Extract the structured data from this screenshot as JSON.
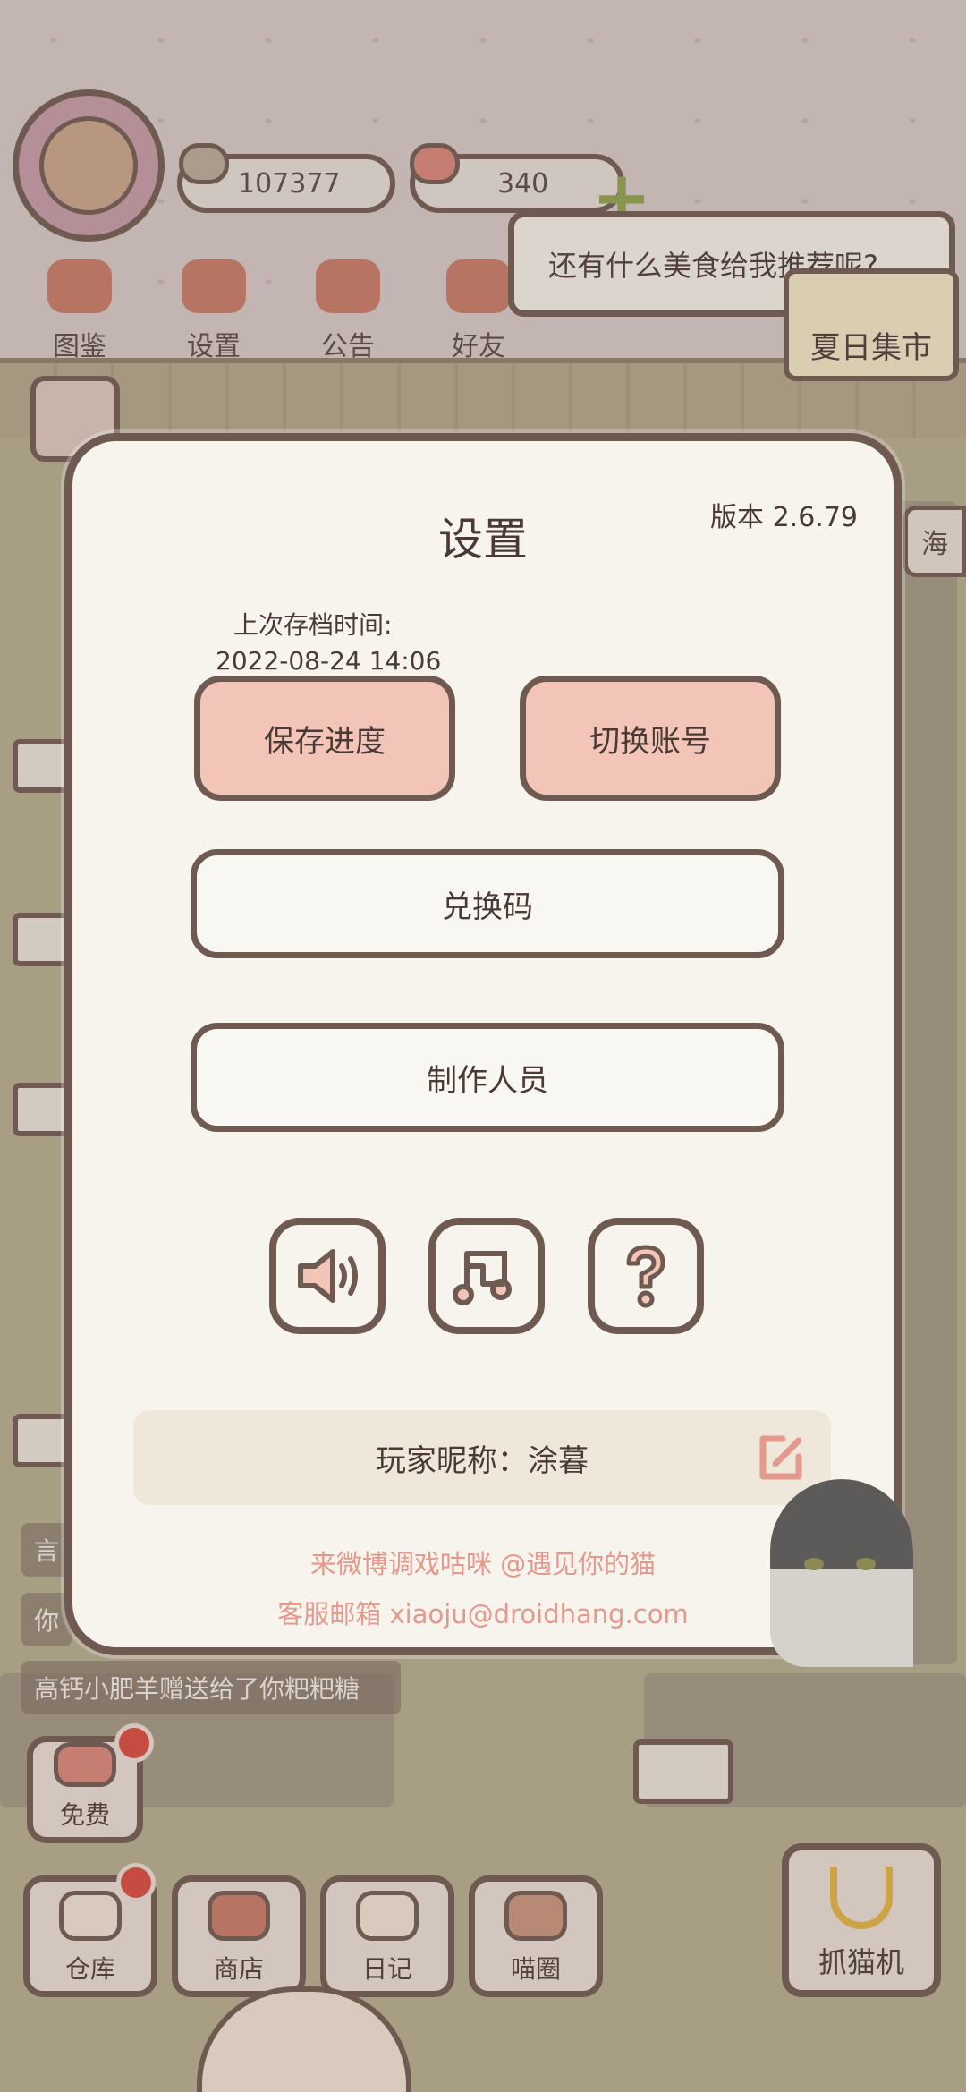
{
  "hud": {
    "fish_count": "107377",
    "heart_count": "340",
    "speech_bubble": "还有什么美食给我推荐呢?",
    "event_badge": "夏日集市",
    "side_tag": "海",
    "top_menu": [
      {
        "label": "图鉴",
        "icon": "cat-book-icon"
      },
      {
        "label": "设置",
        "icon": "gear-icon"
      },
      {
        "label": "公告",
        "icon": "gift-icon"
      },
      {
        "label": "好友",
        "icon": "friends-icon"
      }
    ]
  },
  "chat": [
    "言",
    "你",
    "高钙小肥羊赠送给了你粑粑糖"
  ],
  "bottom_bar": {
    "free": "免费",
    "warehouse": "仓库",
    "shop": "商店",
    "diary": "日记",
    "circle": "喵圈",
    "claw_machine": "抓猫机"
  },
  "settings": {
    "title": "设置",
    "version": "版本 2.6.79",
    "last_save_label": "上次存档时间:",
    "last_save_time": "2022-08-24 14:06",
    "save_button": "保存进度",
    "switch_account_button": "切换账号",
    "redeem_button": "兑换码",
    "credits_button": "制作人员",
    "sound_icon": "speaker-icon",
    "music_icon": "music-note-icon",
    "help_icon": "question-icon",
    "nickname": "玩家昵称：涂暮",
    "weibo_text": "来微博调戏咕咪 @遇见你的猫",
    "email_text": "客服邮箱 xiaoju@droidhang.com"
  },
  "colors": {
    "outline": "#6e5a50",
    "pink_button": "#f3c5b8",
    "panel": "#f7f4ee",
    "link_text": "#e39a8d"
  }
}
